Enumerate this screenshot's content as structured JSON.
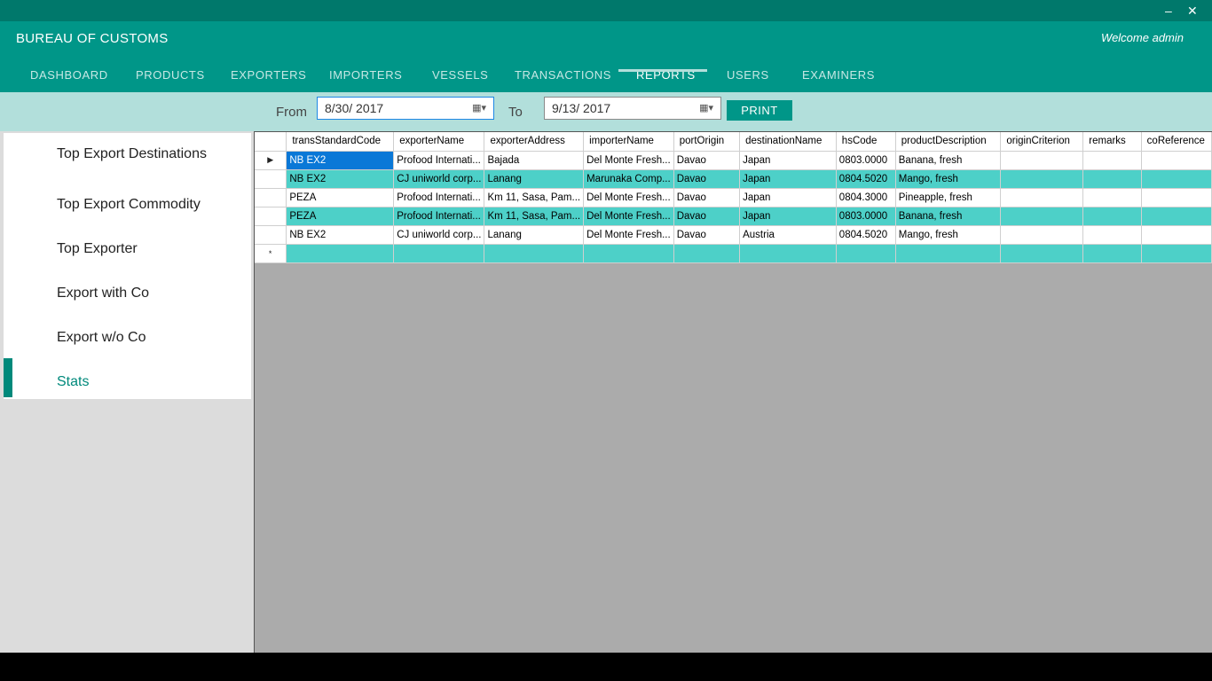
{
  "app": {
    "title": "BUREAU OF CUSTOMS",
    "welcome": "Welcome admin"
  },
  "window_controls": {
    "minimize_icon": "minimize-icon",
    "close_icon": "close-icon",
    "minimize": "–",
    "close": "✕"
  },
  "nav": {
    "items": [
      "DASHBOARD",
      "PRODUCTS",
      "EXPORTERS",
      "IMPORTERS",
      "VESSELS",
      "TRANSACTIONS",
      "REPORTS",
      "USERS",
      "EXAMINERS"
    ],
    "active": "REPORTS"
  },
  "filter": {
    "from_label": "From",
    "from_value": "8/30/ 2017",
    "to_label": "To",
    "to_value": "9/13/ 2017",
    "print_label": "PRINT",
    "calendar_icon": "calendar-dropdown-icon"
  },
  "sidebar": {
    "items": [
      "Top Export Destinations",
      "Top Export Commodity",
      "Top Exporter",
      "Export with Co",
      "Export w/o Co",
      "Stats"
    ],
    "active": "Stats"
  },
  "grid": {
    "columns": [
      "transStandardCode",
      "exporterName",
      "exporterAddress",
      "importerName",
      "portOrigin",
      "destinationName",
      "hsCode",
      "productDescription",
      "originCriterion",
      "remarks",
      "coReference"
    ],
    "rows": [
      [
        "NB EX2",
        "Profood Internati...",
        "Bajada",
        "Del Monte Fresh...",
        "Davao",
        "Japan",
        "0803.0000",
        "Banana, fresh",
        "",
        "",
        ""
      ],
      [
        "NB EX2",
        "CJ uniworld corp...",
        "Lanang",
        "Marunaka Comp...",
        "Davao",
        "Japan",
        "0804.5020",
        "Mango, fresh",
        "",
        "",
        ""
      ],
      [
        "PEZA",
        "Profood Internati...",
        "Km 11, Sasa, Pam...",
        "Del Monte Fresh...",
        "Davao",
        "Japan",
        "0804.3000",
        "Pineapple, fresh",
        "",
        "",
        ""
      ],
      [
        "PEZA",
        "Profood Internati...",
        "Km 11, Sasa, Pam...",
        "Del Monte Fresh...",
        "Davao",
        "Japan",
        "0803.0000",
        "Banana, fresh",
        "",
        "",
        ""
      ],
      [
        "NB EX2",
        "CJ uniworld corp...",
        "Lanang",
        "Del Monte Fresh...",
        "Davao",
        "Austria",
        "0804.5020",
        "Mango, fresh",
        "",
        "",
        ""
      ]
    ],
    "current_row_marker": "▶",
    "new_row_marker": "*",
    "colors": {
      "selected": "#0a78d7",
      "alt_row": "#4dd0c8",
      "empty_area": "#ababab"
    }
  },
  "colors": {
    "header": "#009688",
    "header_dark": "#00786b",
    "filter_bar": "#b2dfdb",
    "accent": "#00897b"
  }
}
